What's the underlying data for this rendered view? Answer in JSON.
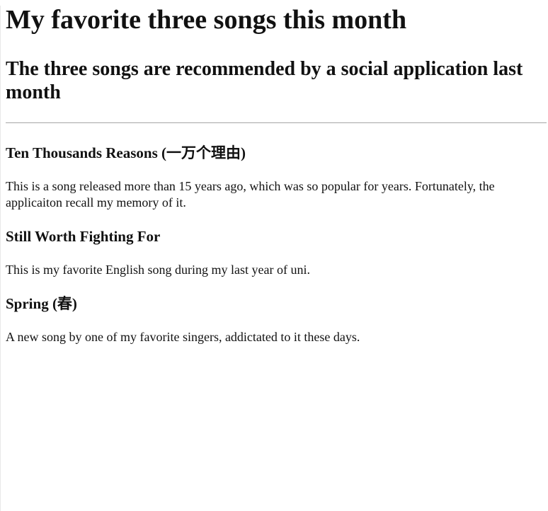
{
  "page": {
    "title": "My favorite three songs this month",
    "subtitle": "The three songs are recommended by a social application last month"
  },
  "songs": [
    {
      "title": "Ten Thousands Reasons (一万个理由)",
      "description": "This is a song released more than 15 years ago, which was so popular for years. Fortunately, the applicaiton recall my memory of it."
    },
    {
      "title": "Still Worth Fighting For",
      "description": "This is my favorite English song during my last year of uni."
    },
    {
      "title": "Spring (春)",
      "description": "A new song by one of my favorite singers, addictated to it these days."
    }
  ],
  "colors": {
    "text": "#111111",
    "rule": "#a6a6a6",
    "background": "#ffffff"
  }
}
